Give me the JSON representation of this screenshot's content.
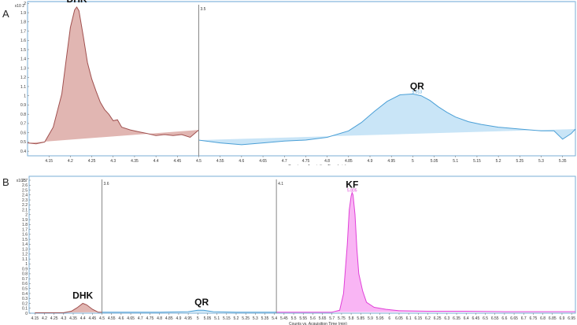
{
  "chart_data": [
    {
      "panel_label": "A",
      "type": "line",
      "yscale_label": "x10 2",
      "xlabel": "Counts vs. Acquisition Time (min)",
      "ylabel": "",
      "xlim": [
        4.1,
        5.38
      ],
      "ylim": [
        0.35,
        2.02
      ],
      "xticks": [
        4.15,
        4.2,
        4.25,
        4.3,
        4.35,
        4.4,
        4.45,
        4.5,
        4.55,
        4.6,
        4.65,
        4.7,
        4.75,
        4.8,
        4.85,
        4.9,
        4.95,
        5,
        5.05,
        5.1,
        5.15,
        5.2,
        5.25,
        5.3,
        5.35
      ],
      "xtick_labels": [
        "4.15",
        "4.2",
        "4.25",
        "4.3",
        "4.35",
        "4.4",
        "4.45",
        "4.5",
        "4.55",
        "4.6",
        "4.65",
        "4.7",
        "4.75",
        "4.8",
        "4.85",
        "4.9",
        "4.95",
        "5",
        "5.05",
        "5.1",
        "5.15",
        "5.2",
        "5.25",
        "5.3",
        "5.35"
      ],
      "yticks": [
        0.4,
        0.5,
        0.6,
        0.7,
        0.8,
        0.9,
        1,
        1.1,
        1.2,
        1.3,
        1.4,
        1.5,
        1.6,
        1.7,
        1.8,
        1.9,
        2
      ],
      "ytick_labels": [
        "0.4",
        "0.5",
        "0.6",
        "0.7",
        "0.8",
        "0.9",
        "1",
        "1.1",
        "1.2",
        "1.3",
        "1.4",
        "1.5",
        "1.6",
        "1.7",
        "1.8",
        "1.9",
        "2"
      ],
      "dividers": [
        {
          "x": 4.5,
          "label": "3.5"
        }
      ],
      "series": [
        {
          "name": "DHK",
          "color": "#a0504f",
          "fill": "#dca9a4",
          "x": [
            4.1,
            4.12,
            4.14,
            4.16,
            4.18,
            4.19,
            4.2,
            4.21,
            4.215,
            4.22,
            4.23,
            4.24,
            4.25,
            4.26,
            4.27,
            4.28,
            4.29,
            4.3,
            4.31,
            4.32,
            4.34,
            4.36,
            4.38,
            4.4,
            4.42,
            4.44,
            4.46,
            4.48,
            4.5
          ],
          "y": [
            0.49,
            0.48,
            0.5,
            0.66,
            1.02,
            1.38,
            1.74,
            1.93,
            1.96,
            1.92,
            1.65,
            1.36,
            1.18,
            1.05,
            0.93,
            0.85,
            0.8,
            0.73,
            0.74,
            0.66,
            0.63,
            0.61,
            0.59,
            0.57,
            0.58,
            0.57,
            0.58,
            0.55,
            0.63
          ],
          "peak_label": "DHK",
          "peak_x": 4.215
        },
        {
          "name": "QR",
          "color": "#4a9fd6",
          "fill": "#bfe0f6",
          "x": [
            4.5,
            4.55,
            4.6,
            4.65,
            4.7,
            4.75,
            4.8,
            4.85,
            4.88,
            4.91,
            4.94,
            4.97,
            5.0,
            5.02,
            5.04,
            5.06,
            5.08,
            5.1,
            5.13,
            5.16,
            5.2,
            5.25,
            5.3,
            5.33,
            5.35,
            5.37,
            5.38
          ],
          "y": [
            0.52,
            0.49,
            0.47,
            0.49,
            0.51,
            0.52,
            0.55,
            0.62,
            0.71,
            0.83,
            0.94,
            1.01,
            1.02,
            1.0,
            0.95,
            0.88,
            0.82,
            0.77,
            0.72,
            0.69,
            0.66,
            0.64,
            0.62,
            0.62,
            0.53,
            0.59,
            0.64
          ],
          "peak_label": "QR",
          "peak_x": 5.01,
          "peak_sub": "5.013"
        }
      ]
    },
    {
      "panel_label": "B",
      "type": "line",
      "yscale_label": "x10 5",
      "xlabel": "Counts vs. Acquisition Time (min)",
      "ylabel": "",
      "xlim": [
        4.12,
        6.97
      ],
      "ylim": [
        0.0,
        2.78
      ],
      "xticks": [
        4.15,
        4.2,
        4.25,
        4.3,
        4.35,
        4.4,
        4.45,
        4.5,
        4.55,
        4.6,
        4.65,
        4.7,
        4.75,
        4.8,
        4.85,
        4.9,
        4.95,
        5,
        5.05,
        5.1,
        5.15,
        5.2,
        5.25,
        5.3,
        5.35,
        5.4,
        5.45,
        5.5,
        5.55,
        5.6,
        5.65,
        5.7,
        5.75,
        5.8,
        5.85,
        5.9,
        5.95,
        6,
        6.05,
        6.1,
        6.15,
        6.2,
        6.25,
        6.3,
        6.35,
        6.4,
        6.45,
        6.5,
        6.55,
        6.6,
        6.65,
        6.7,
        6.75,
        6.8,
        6.85,
        6.9,
        6.95
      ],
      "xtick_labels": [
        "4.15",
        "4.2",
        "4.25",
        "4.3",
        "4.35",
        "4.4",
        "4.45",
        "4.5",
        "4.55",
        "4.6",
        "4.65",
        "4.7",
        "4.75",
        "4.8",
        "4.85",
        "4.9",
        "4.95",
        "5",
        "5.05",
        "5.1",
        "5.15",
        "5.2",
        "5.25",
        "5.3",
        "5.35",
        "5.4",
        "5.45",
        "5.5",
        "5.55",
        "5.6",
        "5.65",
        "5.7",
        "5.75",
        "5.8",
        "5.85",
        "5.9",
        "5.95",
        "6",
        "6.05",
        "6.1",
        "6.15",
        "6.2",
        "6.25",
        "6.3",
        "6.35",
        "6.4",
        "6.45",
        "6.5",
        "6.55",
        "6.6",
        "6.65",
        "6.7",
        "6.75",
        "6.8",
        "6.85",
        "6.9",
        "6.95"
      ],
      "yticks": [
        0,
        0.1,
        0.2,
        0.3,
        0.4,
        0.5,
        0.6,
        0.7,
        0.8,
        0.9,
        1,
        1.1,
        1.2,
        1.3,
        1.4,
        1.5,
        1.6,
        1.7,
        1.8,
        1.9,
        2,
        2.1,
        2.2,
        2.3,
        2.4,
        2.5,
        2.6,
        2.7
      ],
      "ytick_labels": [
        "0",
        "0.1",
        "0.2",
        "0.3",
        "0.4",
        "0.5",
        "0.6",
        "0.7",
        "0.8",
        "0.9",
        "1",
        "1.1",
        "1.2",
        "1.3",
        "1.4",
        "1.5",
        "1.6",
        "1.7",
        "1.8",
        "1.9",
        "2",
        "2.1",
        "2.2",
        "2.3",
        "2.4",
        "2.5",
        "2.6",
        "2.7"
      ],
      "dividers": [
        {
          "x": 4.5,
          "label": "3.6"
        },
        {
          "x": 5.41,
          "label": "4.1"
        }
      ],
      "series": [
        {
          "name": "DHK",
          "color": "#a0504f",
          "fill": "#dca9a4",
          "x": [
            4.15,
            4.3,
            4.34,
            4.37,
            4.4,
            4.42,
            4.45,
            4.48,
            4.5
          ],
          "y": [
            0.01,
            0.01,
            0.04,
            0.11,
            0.2,
            0.17,
            0.08,
            0.02,
            0.02
          ],
          "peak_label": "DHK",
          "peak_x": 4.4
        },
        {
          "name": "QR",
          "color": "#4a9fd6",
          "fill": "#bfe0f6",
          "x": [
            4.5,
            4.8,
            4.95,
            5.0,
            5.03,
            5.08,
            5.2,
            5.41
          ],
          "y": [
            0.02,
            0.02,
            0.03,
            0.06,
            0.06,
            0.03,
            0.02,
            0.02
          ],
          "peak_label": "QR",
          "peak_x": 5.02
        },
        {
          "name": "KF",
          "color": "#e040d8",
          "fill": "#f8a8f2",
          "x": [
            5.41,
            5.6,
            5.7,
            5.74,
            5.76,
            5.78,
            5.79,
            5.8,
            5.805,
            5.81,
            5.82,
            5.83,
            5.84,
            5.86,
            5.88,
            5.92,
            5.98,
            6.05,
            6.2,
            6.4,
            6.6,
            6.8,
            6.97
          ],
          "y": [
            0.02,
            0.02,
            0.02,
            0.06,
            0.4,
            1.4,
            2.1,
            2.38,
            2.45,
            2.4,
            2.0,
            1.3,
            0.8,
            0.45,
            0.22,
            0.12,
            0.08,
            0.05,
            0.04,
            0.04,
            0.03,
            0.03,
            0.03
          ],
          "peak_label": "KF",
          "peak_x": 5.805,
          "peak_sub": "5.805"
        }
      ]
    }
  ]
}
